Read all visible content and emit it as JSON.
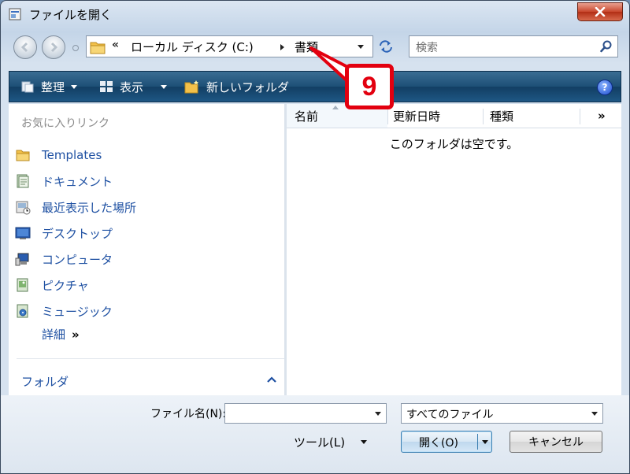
{
  "window": {
    "title": "ファイルを開く"
  },
  "address": {
    "segments": [
      "ローカル ディスク (C:)",
      "書類"
    ],
    "overflow_glyph": "«"
  },
  "search": {
    "placeholder": "検索"
  },
  "toolbar": {
    "organize_label": "整理",
    "views_label": "表示",
    "new_folder_label": "新しいフォルダ",
    "help_glyph": "?"
  },
  "nav_pane": {
    "favorites_header": "お気に入りリンク",
    "items": [
      {
        "label": "Templates",
        "icon": "folder-icon"
      },
      {
        "label": "ドキュメント",
        "icon": "documents-icon"
      },
      {
        "label": "最近表示した場所",
        "icon": "recent-places-icon"
      },
      {
        "label": "デスクトップ",
        "icon": "desktop-icon"
      },
      {
        "label": "コンピュータ",
        "icon": "computer-icon"
      },
      {
        "label": "ピクチャ",
        "icon": "pictures-icon"
      },
      {
        "label": "ミュージック",
        "icon": "music-icon"
      }
    ],
    "more_label": "詳細",
    "more_glyph": "»",
    "folders_label": "フォルダ"
  },
  "file_list": {
    "columns": [
      "名前",
      "更新日時",
      "種類"
    ],
    "more_columns_glyph": "»",
    "empty_message": "このフォルダは空です。"
  },
  "bottom": {
    "filename_label": "ファイル名(N):",
    "filename_value": "",
    "filetype_value": "すべてのファイル",
    "tools_label": "ツール(L)",
    "open_label": "開く(O)",
    "cancel_label": "キャンセル"
  },
  "callout": {
    "number": "9"
  },
  "colors": {
    "link_blue": "#1e50a2",
    "toolbar_blue": "#1d4f76",
    "callout_red": "#e3000f",
    "close_red": "#c9472d"
  }
}
